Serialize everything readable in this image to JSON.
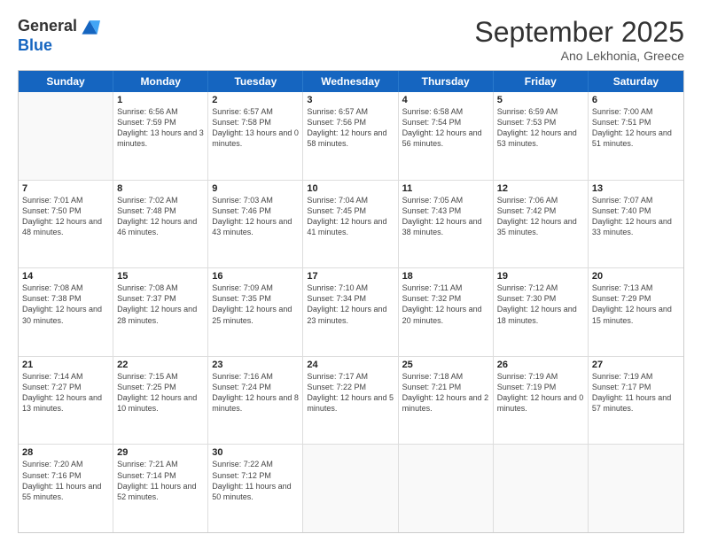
{
  "header": {
    "logo_general": "General",
    "logo_blue": "Blue",
    "month_title": "September 2025",
    "location": "Ano Lekhonia, Greece"
  },
  "days_of_week": [
    "Sunday",
    "Monday",
    "Tuesday",
    "Wednesday",
    "Thursday",
    "Friday",
    "Saturday"
  ],
  "weeks": [
    [
      {
        "day": "",
        "sunrise": "",
        "sunset": "",
        "daylight": ""
      },
      {
        "day": "1",
        "sunrise": "Sunrise: 6:56 AM",
        "sunset": "Sunset: 7:59 PM",
        "daylight": "Daylight: 13 hours and 3 minutes."
      },
      {
        "day": "2",
        "sunrise": "Sunrise: 6:57 AM",
        "sunset": "Sunset: 7:58 PM",
        "daylight": "Daylight: 13 hours and 0 minutes."
      },
      {
        "day": "3",
        "sunrise": "Sunrise: 6:57 AM",
        "sunset": "Sunset: 7:56 PM",
        "daylight": "Daylight: 12 hours and 58 minutes."
      },
      {
        "day": "4",
        "sunrise": "Sunrise: 6:58 AM",
        "sunset": "Sunset: 7:54 PM",
        "daylight": "Daylight: 12 hours and 56 minutes."
      },
      {
        "day": "5",
        "sunrise": "Sunrise: 6:59 AM",
        "sunset": "Sunset: 7:53 PM",
        "daylight": "Daylight: 12 hours and 53 minutes."
      },
      {
        "day": "6",
        "sunrise": "Sunrise: 7:00 AM",
        "sunset": "Sunset: 7:51 PM",
        "daylight": "Daylight: 12 hours and 51 minutes."
      }
    ],
    [
      {
        "day": "7",
        "sunrise": "Sunrise: 7:01 AM",
        "sunset": "Sunset: 7:50 PM",
        "daylight": "Daylight: 12 hours and 48 minutes."
      },
      {
        "day": "8",
        "sunrise": "Sunrise: 7:02 AM",
        "sunset": "Sunset: 7:48 PM",
        "daylight": "Daylight: 12 hours and 46 minutes."
      },
      {
        "day": "9",
        "sunrise": "Sunrise: 7:03 AM",
        "sunset": "Sunset: 7:46 PM",
        "daylight": "Daylight: 12 hours and 43 minutes."
      },
      {
        "day": "10",
        "sunrise": "Sunrise: 7:04 AM",
        "sunset": "Sunset: 7:45 PM",
        "daylight": "Daylight: 12 hours and 41 minutes."
      },
      {
        "day": "11",
        "sunrise": "Sunrise: 7:05 AM",
        "sunset": "Sunset: 7:43 PM",
        "daylight": "Daylight: 12 hours and 38 minutes."
      },
      {
        "day": "12",
        "sunrise": "Sunrise: 7:06 AM",
        "sunset": "Sunset: 7:42 PM",
        "daylight": "Daylight: 12 hours and 35 minutes."
      },
      {
        "day": "13",
        "sunrise": "Sunrise: 7:07 AM",
        "sunset": "Sunset: 7:40 PM",
        "daylight": "Daylight: 12 hours and 33 minutes."
      }
    ],
    [
      {
        "day": "14",
        "sunrise": "Sunrise: 7:08 AM",
        "sunset": "Sunset: 7:38 PM",
        "daylight": "Daylight: 12 hours and 30 minutes."
      },
      {
        "day": "15",
        "sunrise": "Sunrise: 7:08 AM",
        "sunset": "Sunset: 7:37 PM",
        "daylight": "Daylight: 12 hours and 28 minutes."
      },
      {
        "day": "16",
        "sunrise": "Sunrise: 7:09 AM",
        "sunset": "Sunset: 7:35 PM",
        "daylight": "Daylight: 12 hours and 25 minutes."
      },
      {
        "day": "17",
        "sunrise": "Sunrise: 7:10 AM",
        "sunset": "Sunset: 7:34 PM",
        "daylight": "Daylight: 12 hours and 23 minutes."
      },
      {
        "day": "18",
        "sunrise": "Sunrise: 7:11 AM",
        "sunset": "Sunset: 7:32 PM",
        "daylight": "Daylight: 12 hours and 20 minutes."
      },
      {
        "day": "19",
        "sunrise": "Sunrise: 7:12 AM",
        "sunset": "Sunset: 7:30 PM",
        "daylight": "Daylight: 12 hours and 18 minutes."
      },
      {
        "day": "20",
        "sunrise": "Sunrise: 7:13 AM",
        "sunset": "Sunset: 7:29 PM",
        "daylight": "Daylight: 12 hours and 15 minutes."
      }
    ],
    [
      {
        "day": "21",
        "sunrise": "Sunrise: 7:14 AM",
        "sunset": "Sunset: 7:27 PM",
        "daylight": "Daylight: 12 hours and 13 minutes."
      },
      {
        "day": "22",
        "sunrise": "Sunrise: 7:15 AM",
        "sunset": "Sunset: 7:25 PM",
        "daylight": "Daylight: 12 hours and 10 minutes."
      },
      {
        "day": "23",
        "sunrise": "Sunrise: 7:16 AM",
        "sunset": "Sunset: 7:24 PM",
        "daylight": "Daylight: 12 hours and 8 minutes."
      },
      {
        "day": "24",
        "sunrise": "Sunrise: 7:17 AM",
        "sunset": "Sunset: 7:22 PM",
        "daylight": "Daylight: 12 hours and 5 minutes."
      },
      {
        "day": "25",
        "sunrise": "Sunrise: 7:18 AM",
        "sunset": "Sunset: 7:21 PM",
        "daylight": "Daylight: 12 hours and 2 minutes."
      },
      {
        "day": "26",
        "sunrise": "Sunrise: 7:19 AM",
        "sunset": "Sunset: 7:19 PM",
        "daylight": "Daylight: 12 hours and 0 minutes."
      },
      {
        "day": "27",
        "sunrise": "Sunrise: 7:19 AM",
        "sunset": "Sunset: 7:17 PM",
        "daylight": "Daylight: 11 hours and 57 minutes."
      }
    ],
    [
      {
        "day": "28",
        "sunrise": "Sunrise: 7:20 AM",
        "sunset": "Sunset: 7:16 PM",
        "daylight": "Daylight: 11 hours and 55 minutes."
      },
      {
        "day": "29",
        "sunrise": "Sunrise: 7:21 AM",
        "sunset": "Sunset: 7:14 PM",
        "daylight": "Daylight: 11 hours and 52 minutes."
      },
      {
        "day": "30",
        "sunrise": "Sunrise: 7:22 AM",
        "sunset": "Sunset: 7:12 PM",
        "daylight": "Daylight: 11 hours and 50 minutes."
      },
      {
        "day": "",
        "sunrise": "",
        "sunset": "",
        "daylight": ""
      },
      {
        "day": "",
        "sunrise": "",
        "sunset": "",
        "daylight": ""
      },
      {
        "day": "",
        "sunrise": "",
        "sunset": "",
        "daylight": ""
      },
      {
        "day": "",
        "sunrise": "",
        "sunset": "",
        "daylight": ""
      }
    ]
  ]
}
